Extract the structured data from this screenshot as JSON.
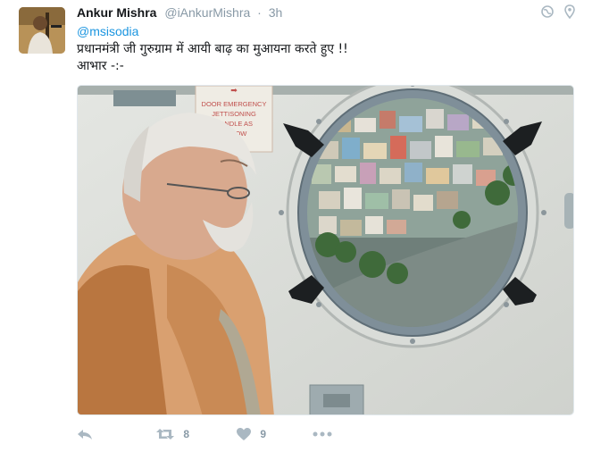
{
  "user": {
    "name": "Ankur Mishra",
    "handle": "@iAnkurMishra",
    "separator": "·",
    "time": "3h"
  },
  "tweet": {
    "mention": "@msisodia",
    "line1": "प्रधानमंत्री जी गुरुग्राम में आयी बाढ़ का मुआयना करते हुए !!",
    "line2": "आभार -:-"
  },
  "media": {
    "sign_text": [
      "DOOR EMERGENCY",
      "JETTISONING",
      "HANDLE AS",
      "ARROW"
    ]
  },
  "actions": {
    "retweet_count": "8",
    "like_count": "9"
  },
  "colors": {
    "mention": "#1b95e0",
    "meta": "#8899a6",
    "icon": "#aab8c2"
  },
  "icons": [
    "globe-icon",
    "location-pin-icon",
    "reply-icon",
    "retweet-icon",
    "heart-icon",
    "more-icon"
  ]
}
